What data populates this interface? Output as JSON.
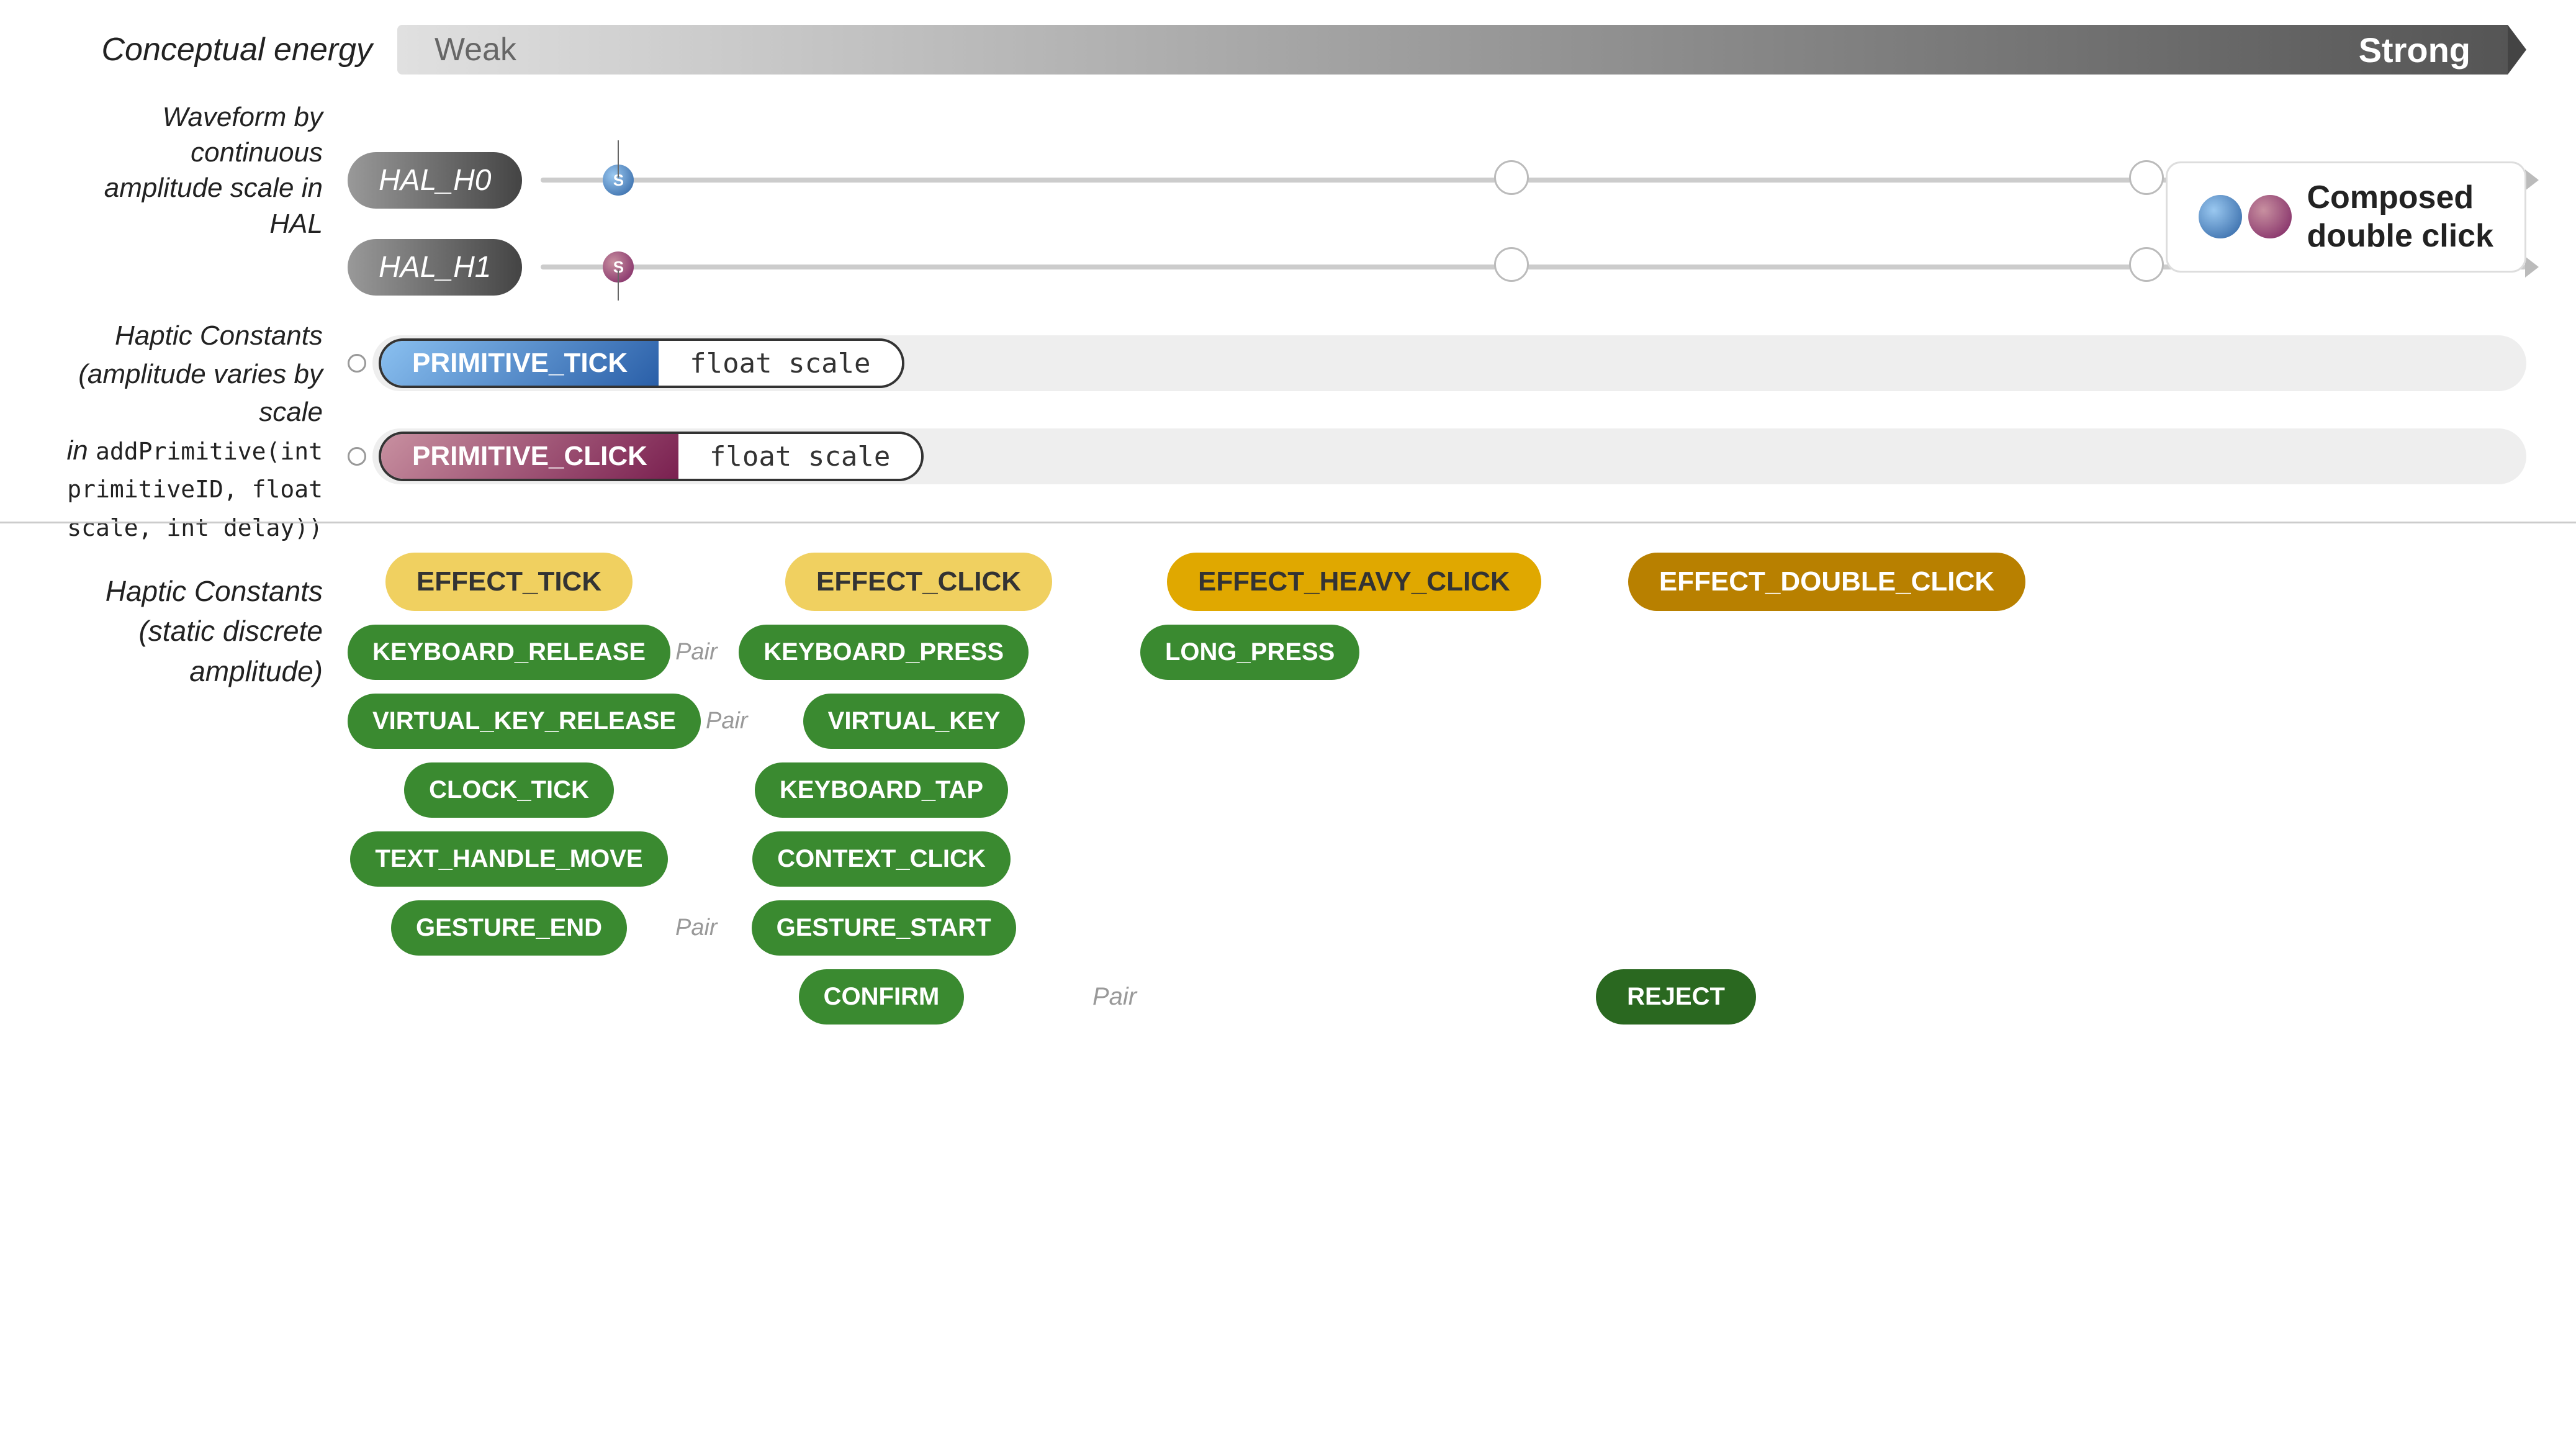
{
  "conceptual_energy": {
    "label": "Conceptual energy",
    "weak": "Weak",
    "strong": "Strong"
  },
  "waveform_label": "Waveform by continuous\namplitude scale in HAL",
  "hal_rows": [
    {
      "label": "HAL_H0",
      "dot_type": "blue",
      "dot_label": "S"
    },
    {
      "label": "HAL_H1",
      "dot_type": "purple",
      "dot_label": "S"
    }
  ],
  "composed_badge": {
    "text_line1": "Composed",
    "text_line2": "double click"
  },
  "haptic_constants_label": "Haptic Constants\n(amplitude varies by scale\nin addPrimitive(int\nprimitiveID, float\nscale, int delay))",
  "primitives": [
    {
      "name": "PRIMITIVE_TICK",
      "scale": "float scale",
      "type": "tick"
    },
    {
      "name": "PRIMITIVE_CLICK",
      "scale": "float scale",
      "type": "click"
    }
  ],
  "haptic_discrete_label": "Haptic Constants\n(static discrete\namplitude)",
  "effects": {
    "row1": [
      {
        "label": "EFFECT_TICK",
        "style": "yellow-light"
      },
      {
        "label": "EFFECT_CLICK",
        "style": "yellow-light"
      },
      {
        "label": "EFFECT_HEAVY_CLICK",
        "style": "yellow-mid"
      },
      {
        "label": "EFFECT_DOUBLE_CLICK",
        "style": "yellow-dark"
      }
    ]
  },
  "discrete_rows": [
    {
      "col1": {
        "label": "KEYBOARD_RELEASE",
        "style": "green"
      },
      "pair": "Pair",
      "col2": {
        "label": "KEYBOARD_PRESS",
        "style": "green"
      },
      "col3": {
        "label": "LONG_PRESS",
        "style": "green"
      },
      "col4": null
    },
    {
      "col1": {
        "label": "VIRTUAL_KEY_RELEASE",
        "style": "green"
      },
      "pair": "Pair",
      "col2": {
        "label": "VIRTUAL_KEY",
        "style": "green"
      },
      "col3": null,
      "col4": null
    },
    {
      "col1": {
        "label": "CLOCK_TICK",
        "style": "green"
      },
      "pair": null,
      "col2": {
        "label": "KEYBOARD_TAP",
        "style": "green"
      },
      "col3": null,
      "col4": null
    },
    {
      "col1": {
        "label": "TEXT_HANDLE_MOVE",
        "style": "green"
      },
      "pair": null,
      "col2": {
        "label": "CONTEXT_CLICK",
        "style": "green"
      },
      "col3": null,
      "col4": null
    },
    {
      "col1": {
        "label": "GESTURE_END",
        "style": "green"
      },
      "pair": "Pair",
      "col2": {
        "label": "GESTURE_START",
        "style": "green"
      },
      "col3": null,
      "col4": null
    },
    {
      "col1": null,
      "pair": null,
      "col2": {
        "label": "CONFIRM",
        "style": "green"
      },
      "col3_pair": "Pair",
      "col4": {
        "label": "REJECT",
        "style": "green-dark"
      }
    }
  ]
}
